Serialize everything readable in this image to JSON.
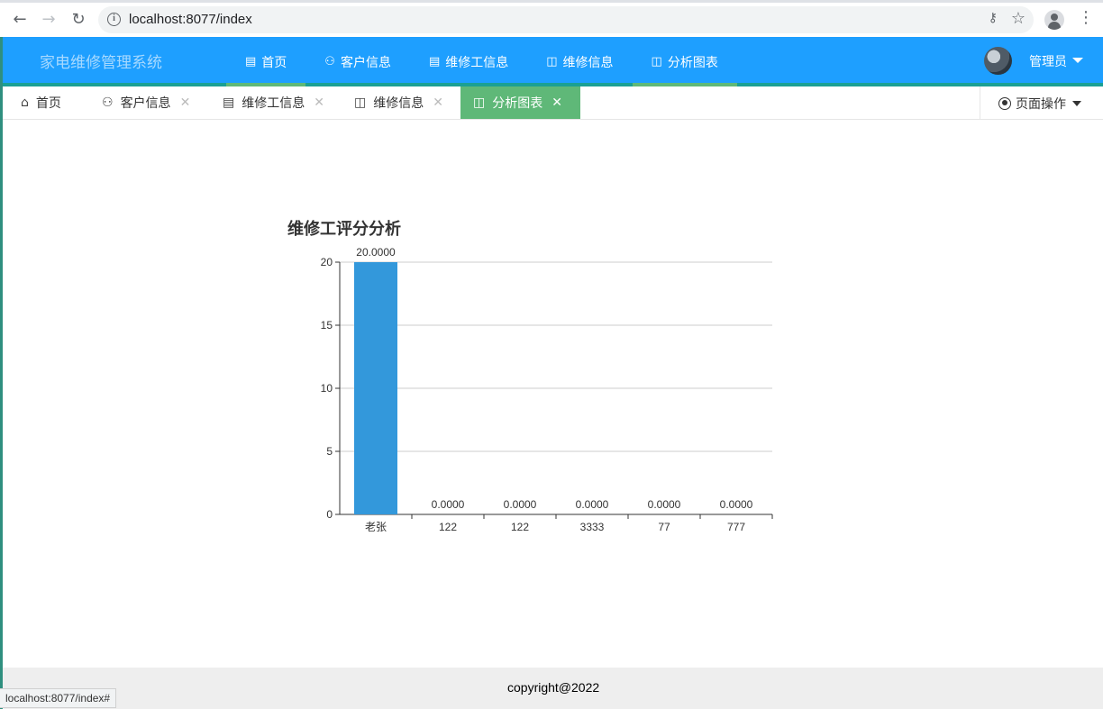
{
  "browser": {
    "url": "localhost:8077/index",
    "status_url": "localhost:8077/index#"
  },
  "header": {
    "logo": "家电维修管理系统",
    "nav": [
      {
        "label": "首页",
        "icon": "clipboard-icon",
        "active": true
      },
      {
        "label": "客户信息",
        "icon": "users-icon",
        "active": false
      },
      {
        "label": "维修工信息",
        "icon": "clipboard-icon",
        "active": false
      },
      {
        "label": "维修信息",
        "icon": "book-icon",
        "active": false
      },
      {
        "label": "分析图表",
        "icon": "book-icon",
        "active": true
      }
    ],
    "user": "管理员"
  },
  "tabs": {
    "items": [
      {
        "label": "首页",
        "icon": "home-icon",
        "closable": false
      },
      {
        "label": "客户信息",
        "icon": "users-icon",
        "closable": true
      },
      {
        "label": "维修工信息",
        "icon": "clipboard-icon",
        "closable": true
      },
      {
        "label": "维修信息",
        "icon": "book-icon",
        "closable": true
      },
      {
        "label": "分析图表",
        "icon": "book-icon",
        "closable": true,
        "active": true
      }
    ],
    "page_ops": "页面操作"
  },
  "chart_data": {
    "type": "bar",
    "title": "维修工评分分析",
    "categories": [
      "老张",
      "122",
      "122",
      "3333",
      "77",
      "777"
    ],
    "values": [
      20,
      0,
      0,
      0,
      0,
      0
    ],
    "data_labels": [
      "20.0000",
      "0.0000",
      "0.0000",
      "0.0000",
      "0.0000",
      "0.0000"
    ],
    "ylim": [
      0,
      20
    ],
    "yticks": [
      0,
      5,
      10,
      15,
      20
    ],
    "grid": true,
    "bar_color": "#3398db"
  },
  "footer": {
    "copyright": "copyright@2022"
  }
}
